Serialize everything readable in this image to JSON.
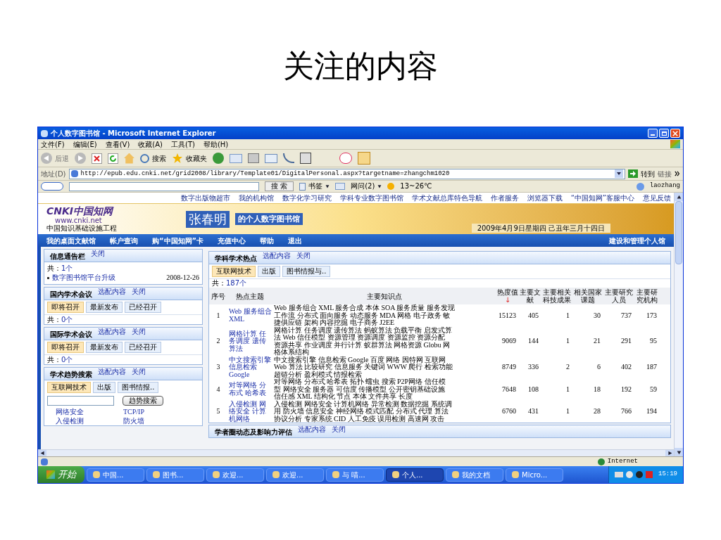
{
  "slide_title": "关注的内容",
  "window": {
    "title": "个人数字图书馆 - Microsoft Internet Explorer"
  },
  "menu": [
    "文件(F)",
    "编辑(E)",
    "查看(V)",
    "收藏(A)",
    "工具(T)",
    "帮助(H)"
  ],
  "toolbar": {
    "back": "后退",
    "search": "搜索",
    "favorites": "收藏夹"
  },
  "address": {
    "label": "地址(D)",
    "url": "http://epub.edu.cnki.net/grid2008/library/Template01/DigitalPersonal.aspx?targetname=zhangchm1020",
    "go": "转到",
    "links": "链接"
  },
  "soso": {
    "search": "搜 索",
    "bookmarks": "书签",
    "wenwen": "网问(2)",
    "weather": "13~26℃",
    "user": "laozhang"
  },
  "top_links": [
    "数字出版物超市",
    "我的机构馆",
    "数字化学习研究",
    "学科专业数字图书馆",
    "学术文献总库特色导航",
    "作者服务",
    "浏览器下载",
    "“中国知网”客服中心",
    "意见反馈"
  ],
  "logo": {
    "brand": "CNKI中国知网",
    "url": "www.cnki.net",
    "tagline": "中国知识基础设施工程"
  },
  "banner": {
    "owner": "张春明",
    "library": "的个人数字图书馆",
    "date": "2009年4月9日星期四 己丑年三月十四日"
  },
  "nav": [
    "我的桌面文献馆",
    "帐户查询",
    "购“中国知网”卡",
    "充值中心",
    "帮助",
    "退出"
  ],
  "nav_right": "建设和管理个人馆",
  "left_panels": [
    {
      "kind": "notice",
      "title": "信息通告栏",
      "actions": [
        "关闭"
      ],
      "count_label": "共：",
      "count": "1个",
      "items": [
        {
          "text": "数字图书馆平台升级",
          "date": "2008-12-26"
        }
      ]
    },
    {
      "kind": "tabs",
      "title": "国内学术会议",
      "actions": [
        "选配内容",
        "关闭"
      ],
      "tabs": [
        {
          "label": "即将召开",
          "selected": true
        },
        {
          "label": "最新发布",
          "selected": false
        },
        {
          "label": "已经召开",
          "selected": false
        }
      ],
      "count_label": "共：",
      "count": "0个"
    },
    {
      "kind": "tabs",
      "title": "国际学术会议",
      "actions": [
        "选配内容",
        "关闭"
      ],
      "tabs": [
        {
          "label": "即将召开",
          "selected": true
        },
        {
          "label": "最新发布",
          "selected": false
        },
        {
          "label": "已经召开",
          "selected": false
        }
      ],
      "count_label": "共：",
      "count": "0个"
    },
    {
      "kind": "trend",
      "title": "学术趋势搜索",
      "actions": [
        "选配内容",
        "关闭"
      ],
      "tabs": [
        {
          "label": "互联网技术",
          "selected": true
        },
        {
          "label": "出版",
          "selected": false
        },
        {
          "label": "图书情报..",
          "selected": false
        }
      ],
      "button": "趋势搜索",
      "links": [
        "网络安全",
        "TCP/IP",
        "入侵检测",
        "防火墙"
      ]
    }
  ],
  "hot_panel": {
    "title": "学科学术热点",
    "actions": [
      "选配内容",
      "关闭"
    ],
    "tabs": [
      {
        "label": "互联网技术",
        "selected": true
      },
      {
        "label": "出版",
        "selected": false
      },
      {
        "label": "图书情报与..",
        "selected": false
      }
    ],
    "count_label": "共：",
    "count": "187个",
    "sort_mark": "↓",
    "columns": [
      "序号",
      "热点主题",
      "主要知识点",
      "热度值",
      "主要文献",
      "主要相关科技成果",
      "相关国家课题",
      "主要研究人员",
      "主要研究机构"
    ],
    "rows": [
      {
        "num": "1",
        "topic": [
          "Web 服务组合",
          "XML"
        ],
        "keywords": [
          "Web 服务组合 XML 服务合成 本体 SOA 服务质量 服务发现",
          "工作流 分布式 面向服务 动态服务 MDA 网格 电子政务 敏",
          "捷供应链 架构 内容挖掘 电子商务 J2EE"
        ],
        "heat": "15123",
        "docs": "405",
        "achievements": "1",
        "projects": "30",
        "researchers": "737",
        "institutions": "173"
      },
      {
        "num": "2",
        "topic": [
          "网格计算 任",
          "务调度 遗传",
          "算法"
        ],
        "keywords": [
          "网格计算 任务调度 遗传算法 蚂蚁算法 负载平衡 启发式算",
          "法 Web 信任模型 资源管理 资源调度 资源监控 资源分配",
          "资源共享 作业调度 并行计算 蚁群算法 网格资源 Globu 网",
          "格体系结构"
        ],
        "heat": "9069",
        "docs": "144",
        "achievements": "1",
        "projects": "21",
        "researchers": "291",
        "institutions": "95"
      },
      {
        "num": "3",
        "topic": [
          "中文搜索引擎",
          "信息检索",
          "Google"
        ],
        "keywords": [
          "中文搜索引擎 信息检索 Google 百度 网络 因特网 互联网",
          "Web 算法 比较研究 信息服务 关键词 WWW 爬行 检索功能",
          "超链分析 盈利模式 情报检索"
        ],
        "heat": "8749",
        "docs": "336",
        "achievements": "2",
        "projects": "6",
        "researchers": "402",
        "institutions": "187"
      },
      {
        "num": "4",
        "topic": [
          "对等网络 分",
          "布式 哈希表"
        ],
        "keywords": [
          "对等网络 分布式 哈希表 拓扑 蠕虫 搜索 P2P网络 信任模",
          "型 网络安全 服务器 可信度 传播模型 公开密钥基础设施",
          "信任感 XML 结构化 节点 本体 文件共享 长度"
        ],
        "heat": "7648",
        "docs": "108",
        "achievements": "1",
        "projects": "18",
        "researchers": "192",
        "institutions": "59"
      },
      {
        "num": "5",
        "topic": [
          "入侵检测 网",
          "络安全 计算",
          "机网络"
        ],
        "keywords": [
          "入侵检测 网络安全 计算机网络 异常检测 数据挖掘 系统调",
          "用 防火墙 信息安全 神经网络 模式匹配 分布式 代理 算法",
          "协议分析 专家系统 CID 人工免疫 误用检测 高速网 攻击"
        ],
        "heat": "6760",
        "docs": "431",
        "achievements": "1",
        "projects": "28",
        "researchers": "766",
        "institutions": "194"
      }
    ]
  },
  "scholar_panel": {
    "title": "学者圈动态及影响力评估",
    "actions": [
      "选配内容",
      "关闭"
    ]
  },
  "status": {
    "zone": "Internet"
  },
  "taskbar": {
    "start": "开始",
    "tasks": [
      {
        "label": "中国...",
        "selected": false
      },
      {
        "label": "图书...",
        "selected": false
      },
      {
        "label": "欢迎...",
        "selected": false
      },
      {
        "label": "欢迎...",
        "selected": false
      },
      {
        "label": "与 喵...",
        "selected": false
      },
      {
        "label": "个人...",
        "selected": true
      },
      {
        "label": "我的文档",
        "selected": false
      },
      {
        "label": "Micro...",
        "selected": false
      }
    ],
    "clock": "15:19"
  }
}
